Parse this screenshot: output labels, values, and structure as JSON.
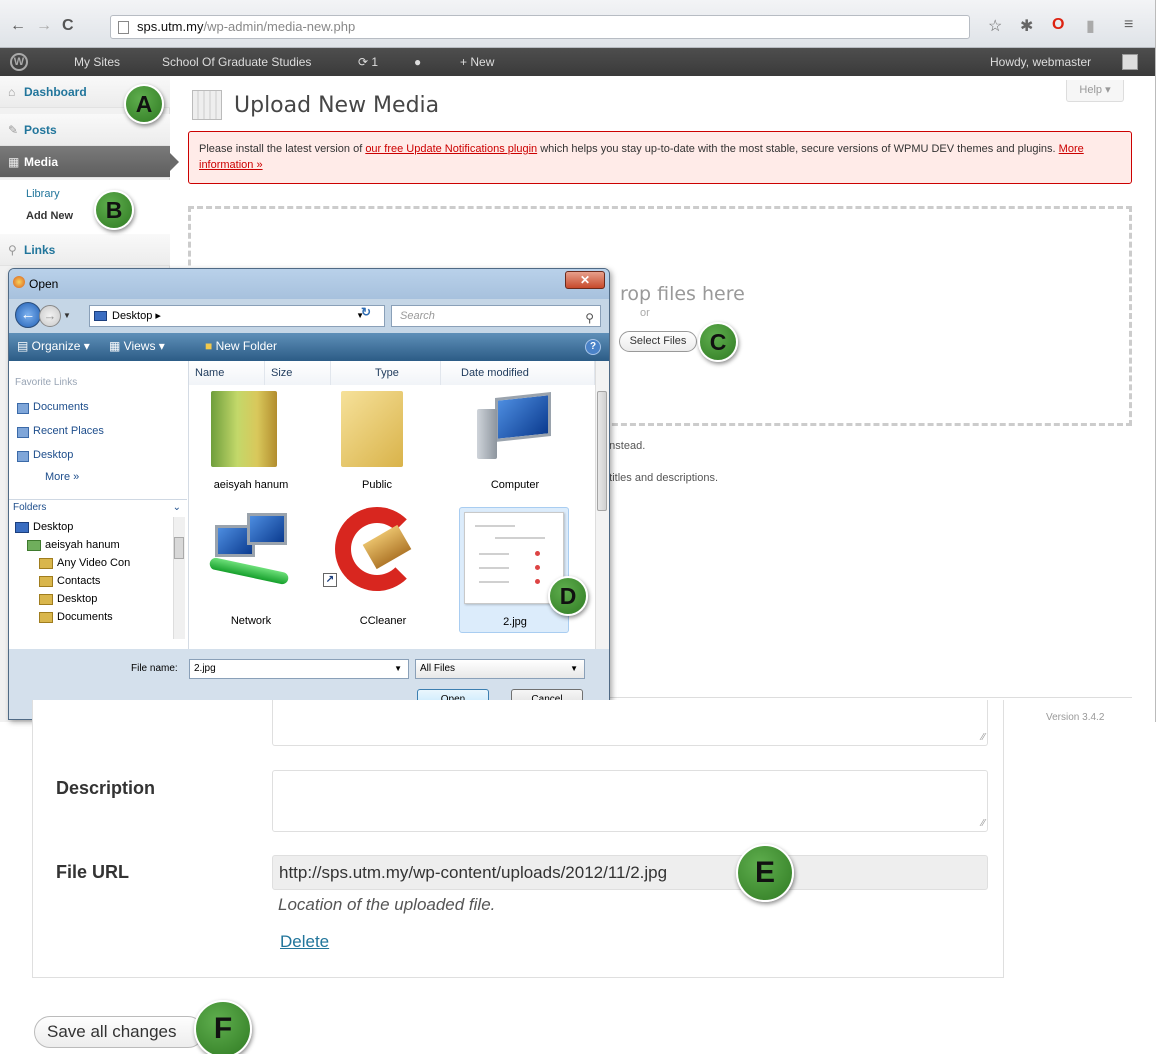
{
  "browser": {
    "url_host": "sps.utm.my",
    "url_path": "/wp-admin/media-new.php"
  },
  "adminbar": {
    "my_sites": "My Sites",
    "site_name": "School Of Graduate Studies",
    "updates": "1",
    "new": "New",
    "howdy": "Howdy, webmaster"
  },
  "sidebar": {
    "dashboard": "Dashboard",
    "posts": "Posts",
    "media": "Media",
    "library": "Library",
    "add_new": "Add New",
    "links": "Links"
  },
  "page": {
    "title": "Upload New Media",
    "help": "Help",
    "notice_before": "Please install the latest version of ",
    "notice_link": "our free Update Notifications plugin",
    "notice_after": " which helps you stay up-to-date with the most stable, secure versions of WPMU DEV themes and plugins. ",
    "notice_more": "More information »",
    "drop_text": "rop files here",
    "drop_or": "or",
    "select_files": "Select Files",
    "instead": "r instead.",
    "titles_text": "d titles and descriptions.",
    "version": "Version 3.4.2"
  },
  "dialog": {
    "title": "Open",
    "path": "Desktop",
    "search_placeholder": "Search",
    "toolbar": {
      "organize": "Organize",
      "views": "Views",
      "new_folder": "New Folder"
    },
    "favorite_links_header": "Favorite Links",
    "favorites": [
      "Documents",
      "Recent Places",
      "Desktop",
      "More »"
    ],
    "folders_header": "Folders",
    "tree": [
      "Desktop",
      "aeisyah hanum",
      "Any Video Con",
      "Contacts",
      "Desktop",
      "Documents"
    ],
    "columns": [
      "Name",
      "Size",
      "Type",
      "Date modified"
    ],
    "files": [
      "aeisyah hanum",
      "Public",
      "Computer",
      "Network",
      "CCleaner",
      "2.jpg"
    ],
    "file_name_label": "File name:",
    "file_name_value": "2.jpg",
    "file_type": "All Files",
    "open_button": "Open",
    "cancel_button": "Cancel"
  },
  "form": {
    "description_label": "Description",
    "file_url_label": "File URL",
    "file_url_value": "http://sps.utm.my/wp-content/uploads/2012/11/2.jpg",
    "file_url_help": "Location of the uploaded file.",
    "delete_link": "Delete",
    "save_button": "Save all changes"
  },
  "markers": [
    "A",
    "B",
    "C",
    "D",
    "E",
    "F"
  ],
  "colors": {
    "marker_green": "#3f8f2f",
    "wp_link": "#21759b",
    "notice_bg": "#ffebe8",
    "notice_border": "#cc0000",
    "adminbar": "#464646"
  }
}
